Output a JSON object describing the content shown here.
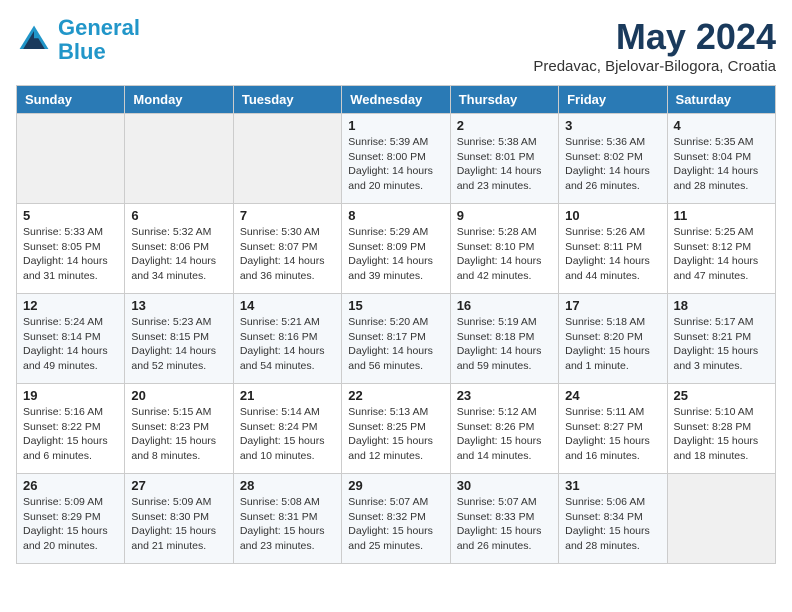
{
  "header": {
    "logo_line1": "General",
    "logo_line2": "Blue",
    "month": "May 2024",
    "location": "Predavac, Bjelovar-Bilogora, Croatia"
  },
  "weekdays": [
    "Sunday",
    "Monday",
    "Tuesday",
    "Wednesday",
    "Thursday",
    "Friday",
    "Saturday"
  ],
  "weeks": [
    [
      {
        "day": "",
        "info": ""
      },
      {
        "day": "",
        "info": ""
      },
      {
        "day": "",
        "info": ""
      },
      {
        "day": "1",
        "info": "Sunrise: 5:39 AM\nSunset: 8:00 PM\nDaylight: 14 hours\nand 20 minutes."
      },
      {
        "day": "2",
        "info": "Sunrise: 5:38 AM\nSunset: 8:01 PM\nDaylight: 14 hours\nand 23 minutes."
      },
      {
        "day": "3",
        "info": "Sunrise: 5:36 AM\nSunset: 8:02 PM\nDaylight: 14 hours\nand 26 minutes."
      },
      {
        "day": "4",
        "info": "Sunrise: 5:35 AM\nSunset: 8:04 PM\nDaylight: 14 hours\nand 28 minutes."
      }
    ],
    [
      {
        "day": "5",
        "info": "Sunrise: 5:33 AM\nSunset: 8:05 PM\nDaylight: 14 hours\nand 31 minutes."
      },
      {
        "day": "6",
        "info": "Sunrise: 5:32 AM\nSunset: 8:06 PM\nDaylight: 14 hours\nand 34 minutes."
      },
      {
        "day": "7",
        "info": "Sunrise: 5:30 AM\nSunset: 8:07 PM\nDaylight: 14 hours\nand 36 minutes."
      },
      {
        "day": "8",
        "info": "Sunrise: 5:29 AM\nSunset: 8:09 PM\nDaylight: 14 hours\nand 39 minutes."
      },
      {
        "day": "9",
        "info": "Sunrise: 5:28 AM\nSunset: 8:10 PM\nDaylight: 14 hours\nand 42 minutes."
      },
      {
        "day": "10",
        "info": "Sunrise: 5:26 AM\nSunset: 8:11 PM\nDaylight: 14 hours\nand 44 minutes."
      },
      {
        "day": "11",
        "info": "Sunrise: 5:25 AM\nSunset: 8:12 PM\nDaylight: 14 hours\nand 47 minutes."
      }
    ],
    [
      {
        "day": "12",
        "info": "Sunrise: 5:24 AM\nSunset: 8:14 PM\nDaylight: 14 hours\nand 49 minutes."
      },
      {
        "day": "13",
        "info": "Sunrise: 5:23 AM\nSunset: 8:15 PM\nDaylight: 14 hours\nand 52 minutes."
      },
      {
        "day": "14",
        "info": "Sunrise: 5:21 AM\nSunset: 8:16 PM\nDaylight: 14 hours\nand 54 minutes."
      },
      {
        "day": "15",
        "info": "Sunrise: 5:20 AM\nSunset: 8:17 PM\nDaylight: 14 hours\nand 56 minutes."
      },
      {
        "day": "16",
        "info": "Sunrise: 5:19 AM\nSunset: 8:18 PM\nDaylight: 14 hours\nand 59 minutes."
      },
      {
        "day": "17",
        "info": "Sunrise: 5:18 AM\nSunset: 8:20 PM\nDaylight: 15 hours\nand 1 minute."
      },
      {
        "day": "18",
        "info": "Sunrise: 5:17 AM\nSunset: 8:21 PM\nDaylight: 15 hours\nand 3 minutes."
      }
    ],
    [
      {
        "day": "19",
        "info": "Sunrise: 5:16 AM\nSunset: 8:22 PM\nDaylight: 15 hours\nand 6 minutes."
      },
      {
        "day": "20",
        "info": "Sunrise: 5:15 AM\nSunset: 8:23 PM\nDaylight: 15 hours\nand 8 minutes."
      },
      {
        "day": "21",
        "info": "Sunrise: 5:14 AM\nSunset: 8:24 PM\nDaylight: 15 hours\nand 10 minutes."
      },
      {
        "day": "22",
        "info": "Sunrise: 5:13 AM\nSunset: 8:25 PM\nDaylight: 15 hours\nand 12 minutes."
      },
      {
        "day": "23",
        "info": "Sunrise: 5:12 AM\nSunset: 8:26 PM\nDaylight: 15 hours\nand 14 minutes."
      },
      {
        "day": "24",
        "info": "Sunrise: 5:11 AM\nSunset: 8:27 PM\nDaylight: 15 hours\nand 16 minutes."
      },
      {
        "day": "25",
        "info": "Sunrise: 5:10 AM\nSunset: 8:28 PM\nDaylight: 15 hours\nand 18 minutes."
      }
    ],
    [
      {
        "day": "26",
        "info": "Sunrise: 5:09 AM\nSunset: 8:29 PM\nDaylight: 15 hours\nand 20 minutes."
      },
      {
        "day": "27",
        "info": "Sunrise: 5:09 AM\nSunset: 8:30 PM\nDaylight: 15 hours\nand 21 minutes."
      },
      {
        "day": "28",
        "info": "Sunrise: 5:08 AM\nSunset: 8:31 PM\nDaylight: 15 hours\nand 23 minutes."
      },
      {
        "day": "29",
        "info": "Sunrise: 5:07 AM\nSunset: 8:32 PM\nDaylight: 15 hours\nand 25 minutes."
      },
      {
        "day": "30",
        "info": "Sunrise: 5:07 AM\nSunset: 8:33 PM\nDaylight: 15 hours\nand 26 minutes."
      },
      {
        "day": "31",
        "info": "Sunrise: 5:06 AM\nSunset: 8:34 PM\nDaylight: 15 hours\nand 28 minutes."
      },
      {
        "day": "",
        "info": ""
      }
    ]
  ]
}
